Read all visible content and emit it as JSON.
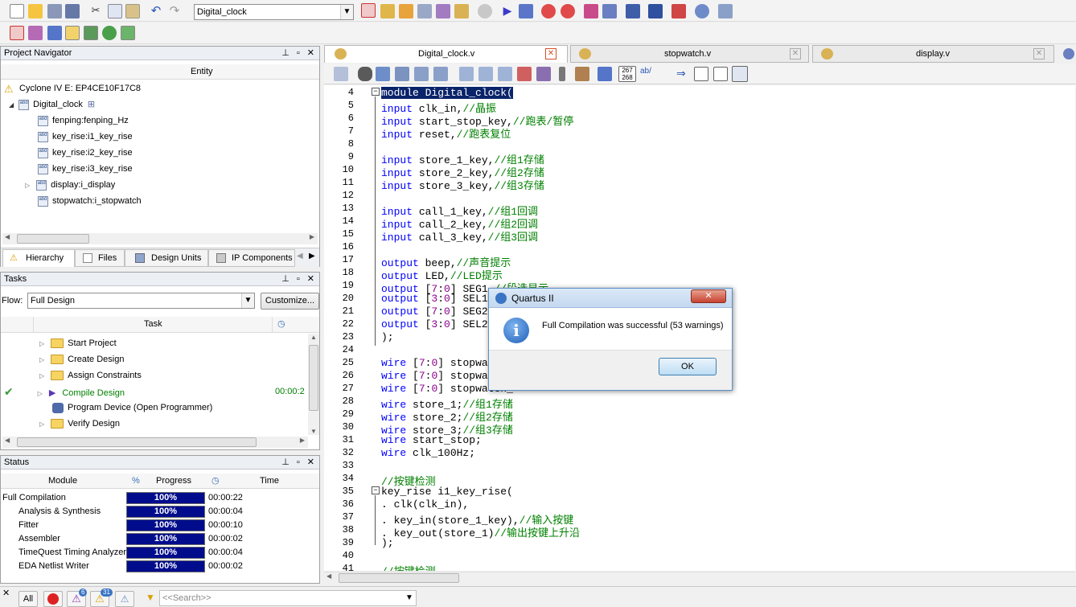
{
  "toolbar": {
    "entity_combo": "Digital_clock",
    "icons": [
      "new-file-icon",
      "open-icon",
      "save-icon",
      "save-all-icon",
      "cut-icon",
      "copy-icon",
      "paste-icon",
      "undo-icon",
      "redo-icon"
    ]
  },
  "project_navigator": {
    "title": "Project Navigator",
    "column": "Entity",
    "device": "Cyclone IV E: EP4CE10F17C8",
    "top": "Digital_clock",
    "items": [
      "fenping:fenping_Hz",
      "key_rise:i1_key_rise",
      "key_rise:i2_key_rise",
      "key_rise:i3_key_rise",
      "display:i_display",
      "stopwatch:i_stopwatch"
    ],
    "tabs": [
      "Hierarchy",
      "Files",
      "Design Units",
      "IP Components"
    ]
  },
  "tasks": {
    "title": "Tasks",
    "flow_label": "Flow:",
    "flow_value": "Full Design",
    "customize": "Customize...",
    "column": "Task",
    "items": [
      "Start Project",
      "Create Design",
      "Assign Constraints",
      "Compile Design",
      "Program Device (Open Programmer)",
      "Verify Design"
    ],
    "compile_time": "00:00:2"
  },
  "status": {
    "title": "Status",
    "columns": [
      "Module",
      "%",
      "Progress",
      "Time"
    ],
    "rows": [
      {
        "module": "Full Compilation",
        "progress": "100%",
        "time": "00:00:22"
      },
      {
        "module": "Analysis & Synthesis",
        "progress": "100%",
        "time": "00:00:04"
      },
      {
        "module": "Fitter",
        "progress": "100%",
        "time": "00:00:10"
      },
      {
        "module": "Assembler",
        "progress": "100%",
        "time": "00:00:02"
      },
      {
        "module": "TimeQuest Timing Analyzer",
        "progress": "100%",
        "time": "00:00:04"
      },
      {
        "module": "EDA Netlist Writer",
        "progress": "100%",
        "time": "00:00:02"
      }
    ]
  },
  "editor": {
    "tabs": [
      "Digital_clock.v",
      "stopwatch.v",
      "display.v"
    ],
    "line_numbers": [
      "4",
      "5",
      "6",
      "7",
      "8",
      "9",
      "10",
      "11",
      "12",
      "13",
      "14",
      "15",
      "16",
      "17",
      "18",
      "19",
      "20",
      "21",
      "22",
      "23",
      "24",
      "25",
      "26",
      "27",
      "28",
      "29",
      "30",
      "31",
      "32",
      "33",
      "34",
      "35",
      "36",
      "37",
      "38",
      "39",
      "40",
      "41"
    ],
    "lines": [
      "module Digital_clock(",
      "input clk_in,//晶振",
      "input start_stop_key,//跑表/暂停",
      "input reset,//跑表复位",
      "",
      "input store_1_key,//组1存储",
      "input store_2_key,//组2存储",
      "input store_3_key,//组3存储",
      "",
      "input call_1_key,//组1回调",
      "input call_2_key,//组2回调",
      "input call_3_key,//组3回调",
      "",
      "output beep,//声音提示",
      "output LED,//LED提示",
      "output [7:0] SEG1,//段选显示",
      "output [3:0] SEL1,",
      "output [7:0] SEG2,",
      "output [3:0] SEL2,",
      ");",
      "",
      "wire [7:0] stopwatch_",
      "wire [7:0] stopwatch_",
      "wire [7:0] stopwatch_",
      "wire store_1;//组1存储",
      "wire store_2;//组2存储",
      "wire store_3;//组3存储",
      "wire start_stop;",
      "wire clk_100Hz;",
      "",
      "//按键检测",
      "key_rise i1_key_rise(",
      ". clk(clk_in),",
      ". key_in(store_1_key),//输入按键",
      ". key_out(store_1)//输出按键上升沿",
      ");",
      "",
      "//按键检测"
    ]
  },
  "dialog": {
    "title": "Quartus II",
    "message": "Full Compilation was successful (53 warnings)",
    "ok": "OK"
  },
  "bottom": {
    "all": "All",
    "badge_6": "6",
    "badge_31": "31",
    "search_placeholder": "<<Search>>"
  }
}
